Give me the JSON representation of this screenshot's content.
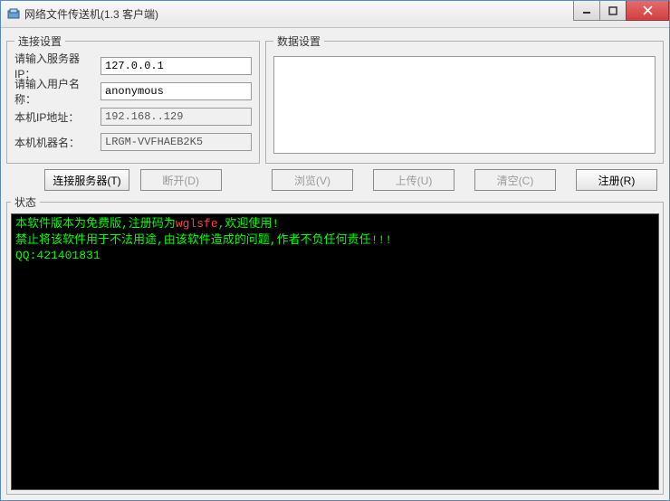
{
  "window": {
    "title": "网络文件传送机(1.3 客户端)"
  },
  "connection": {
    "legend": "连接设置",
    "server_ip_label": "请输入服务器IP：",
    "server_ip_value": "127.0.0.1",
    "username_label": "请输入用户名称：",
    "username_value": "anonymous",
    "local_ip_label": "本机IP地址：",
    "local_ip_value": "192.168..129",
    "machine_name_label": "本机机器名：",
    "machine_name_value": "LRGM-VVFHAEB2K5"
  },
  "data_settings": {
    "legend": "数据设置"
  },
  "buttons": {
    "connect": "连接服务器(T)",
    "disconnect": "断开(D)",
    "browse": "浏览(V)",
    "upload": "上传(U)",
    "clear": "清空(C)",
    "register": "注册(R)"
  },
  "status": {
    "legend": "状态",
    "line1_pre": "本软件版本为免费版,注册码为",
    "line1_code": "wglsfe",
    "line1_post": ",欢迎使用!",
    "line2": "禁止将该软件用于不法用途,由该软件造成的问题,作者不负任何责任!!!",
    "line3": "QQ:421401831"
  }
}
